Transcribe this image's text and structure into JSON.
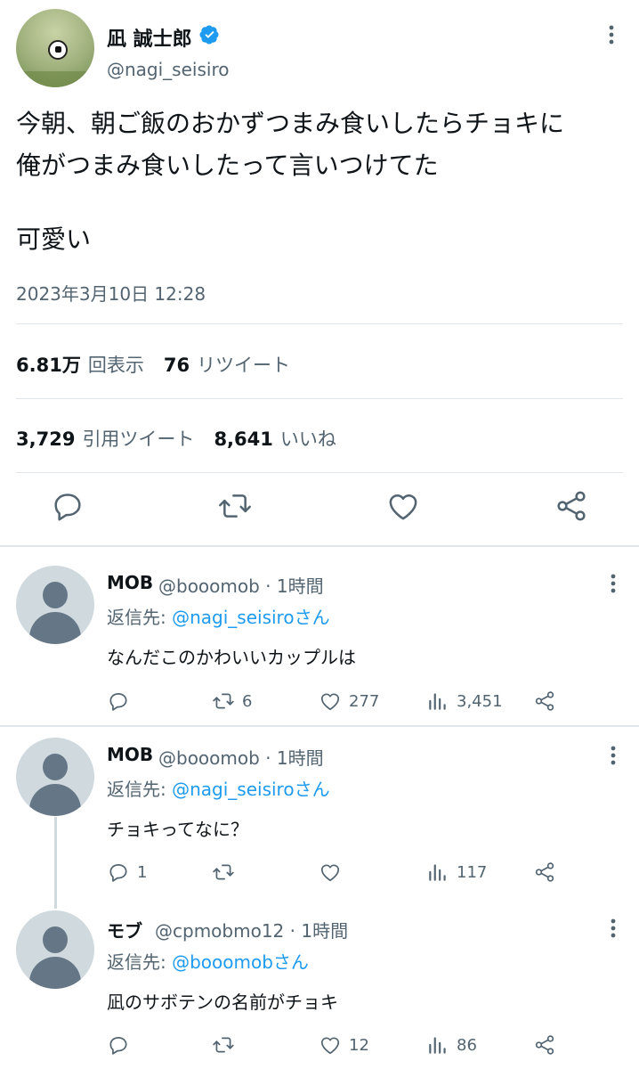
{
  "tweet": {
    "author_name": "凪 誠士郎",
    "author_handle": "@nagi_seisiro",
    "text_line1": "今朝、朝ご飯のおかずつまみ食いしたらチョキに",
    "text_line2": "俺がつまみ食いしたって言いつけてた",
    "text_line3": "可愛い",
    "timestamp": "2023年3月10日 12:28",
    "views_count": "6.81万",
    "views_label": "回表示",
    "retweets_count": "76",
    "retweets_label": "リツイート",
    "quotes_count": "3,729",
    "quotes_label": "引用ツイート",
    "likes_count": "8,641",
    "likes_label": "いいね"
  },
  "replies": [
    {
      "name": "MOB",
      "meta": "@booomob · 1時間",
      "replying_prefix": "返信先: ",
      "replying_to": "@nagi_seisiroさん",
      "text": "なんだこのかわいいカップルは",
      "reply_count": "",
      "retweet_count": "6",
      "like_count": "277",
      "view_count": "3,451"
    },
    {
      "name": "MOB",
      "meta": "@booomob · 1時間",
      "replying_prefix": "返信先: ",
      "replying_to": "@nagi_seisiroさん",
      "text": "チョキってなに？",
      "reply_count": "1",
      "retweet_count": "",
      "like_count": "",
      "view_count": "117"
    },
    {
      "name": "モブ",
      "meta": "@cpmobmo12 · 1時間",
      "replying_prefix": "返信先: ",
      "replying_to": "@booomobさん",
      "text": "凪のサボテンの名前がチョキ",
      "reply_count": "",
      "retweet_count": "",
      "like_count": "12",
      "view_count": "86"
    }
  ],
  "colors": {
    "accent": "#1d9bf0",
    "secondary_text": "#536471",
    "divider": "#e1e6ea"
  },
  "icons": [
    "verified-badge-icon",
    "more-icon",
    "reply-icon",
    "retweet-icon",
    "like-icon",
    "share-icon",
    "views-icon"
  ]
}
